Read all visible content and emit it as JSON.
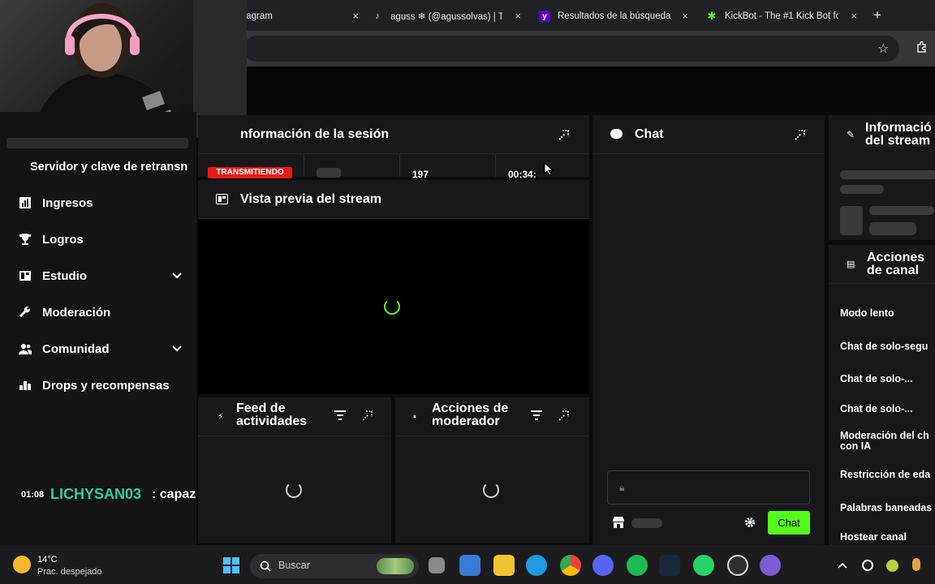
{
  "browser": {
    "tabs": [
      {
        "title": "tagram",
        "icon": "instagram-icon"
      },
      {
        "title": "aguss ❄ (@agussolvas) | Ti",
        "icon": "tiktok-icon"
      },
      {
        "title": "Resultados de la búsqueda",
        "icon": "yahoo-icon"
      },
      {
        "title": "KickBot - The #1 Kick Bot fo",
        "icon": "kickbot-icon"
      }
    ],
    "new_tab": "+",
    "close": "×"
  },
  "sidebar": {
    "top_label": "Servidor y clave de retransn",
    "items": [
      {
        "label": "Ingresos",
        "icon": "bar-chart-icon",
        "expand": false
      },
      {
        "label": "Logros",
        "icon": "trophy-icon",
        "expand": false
      },
      {
        "label": "Estudio",
        "icon": "studio-icon",
        "expand": true
      },
      {
        "label": "Moderación",
        "icon": "wrench-icon",
        "expand": false
      },
      {
        "label": "Comunidad",
        "icon": "users-icon",
        "expand": true
      },
      {
        "label": "Drops y recompensas",
        "icon": "podium-icon",
        "expand": false
      }
    ]
  },
  "session": {
    "title": "nformación de la sesión",
    "badge": "TRANSMITIENDO",
    "viewers": "197",
    "time": "00:34:"
  },
  "preview": {
    "title": "Vista previa del stream"
  },
  "feed": {
    "title_line1": "Feed de",
    "title_line2": "actividades"
  },
  "modactions": {
    "title_line1": "Acciones de",
    "title_line2": "moderador"
  },
  "chat": {
    "title": "Chat",
    "send_label": "Chat"
  },
  "stream_info": {
    "title_line1": "Informació",
    "title_line2": "del stream"
  },
  "channel_actions": {
    "title_line1": "Acciones",
    "title_line2": "de canal",
    "rows": [
      {
        "line1": "Modo lento",
        "line2": ""
      },
      {
        "line1": "Chat de solo-segu",
        "line2": ""
      },
      {
        "line1": "Chat de solo-...",
        "line2": ""
      },
      {
        "line1": "Chat de solo-...",
        "line2": ""
      },
      {
        "line1": "Moderación del ch",
        "line2": "con IA"
      },
      {
        "line1": "Restricción de eda",
        "line2": ""
      },
      {
        "line1": "Palabras baneadas",
        "line2": ""
      },
      {
        "line1": "Hostear canal",
        "line2": ""
      }
    ]
  },
  "overlay_chat": {
    "time": "01:08",
    "user": "LICHYSAN03",
    "message": ": capaz"
  },
  "taskbar": {
    "weather_temp": "14°C",
    "weather_desc": "Prac. despejado",
    "search_placeholder": "Buscar"
  },
  "colors": {
    "accent": "#53fc18",
    "live": "#e91916",
    "username": "#2ecfa0"
  }
}
